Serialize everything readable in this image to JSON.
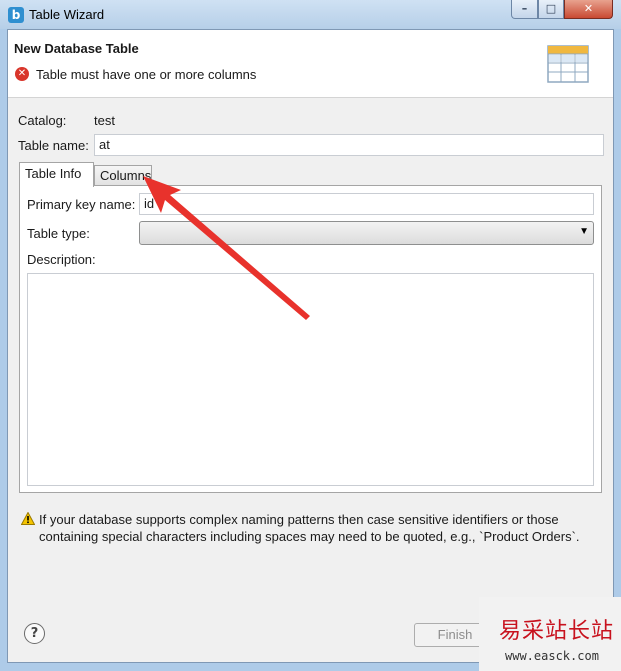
{
  "window": {
    "title": "Table Wizard",
    "app_icon_glyph": "b",
    "controls": {
      "minimize": "–",
      "maximize": "□",
      "close": "✕"
    }
  },
  "header": {
    "title": "New Database Table",
    "message": "Table must have one or more columns",
    "message_icon": "error-icon",
    "graphic": "table-icon"
  },
  "form": {
    "catalog_label": "Catalog:",
    "catalog_value": "test",
    "table_name_label": "Table name:",
    "table_name_value": "at"
  },
  "tabs": [
    {
      "label": "Table Info",
      "active": true
    },
    {
      "label": "Columns",
      "active": false
    }
  ],
  "table_info": {
    "primary_key_label": "Primary key name:",
    "primary_key_value": "id",
    "table_type_label": "Table type:",
    "table_type_value": "",
    "description_label": "Description:",
    "description_value": ""
  },
  "warning": {
    "icon": "warning-icon",
    "text": "If your database supports complex naming patterns then case sensitive identifiers or those containing special characters including spaces may need to be quoted, e.g., `Product Orders`."
  },
  "footer": {
    "help_glyph": "?",
    "finish_label": "Finish",
    "finish_enabled": false
  },
  "watermark": {
    "name": "易采站长站",
    "url": "www.easck.com"
  },
  "annotation": {
    "type": "red-arrow",
    "points_to": "Columns tab",
    "color": "#e8322c"
  },
  "colors": {
    "error": "#d9362b",
    "warning": "#f0b400",
    "arrow": "#e8322c",
    "watermark": "#c8121e"
  }
}
